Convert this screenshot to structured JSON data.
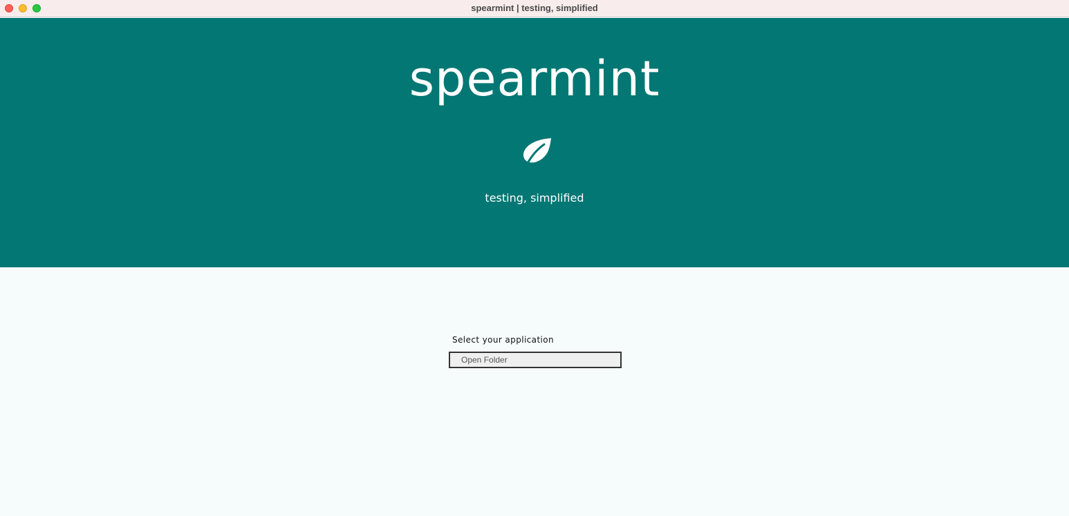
{
  "window": {
    "title": "spearmint | testing, simplified"
  },
  "hero": {
    "brand": "spearmint",
    "icon": "leaf-icon",
    "tagline": "testing, simplified",
    "background_color": "#027773"
  },
  "main": {
    "select_label": "Select your application",
    "open_folder_label": "Open Folder"
  }
}
